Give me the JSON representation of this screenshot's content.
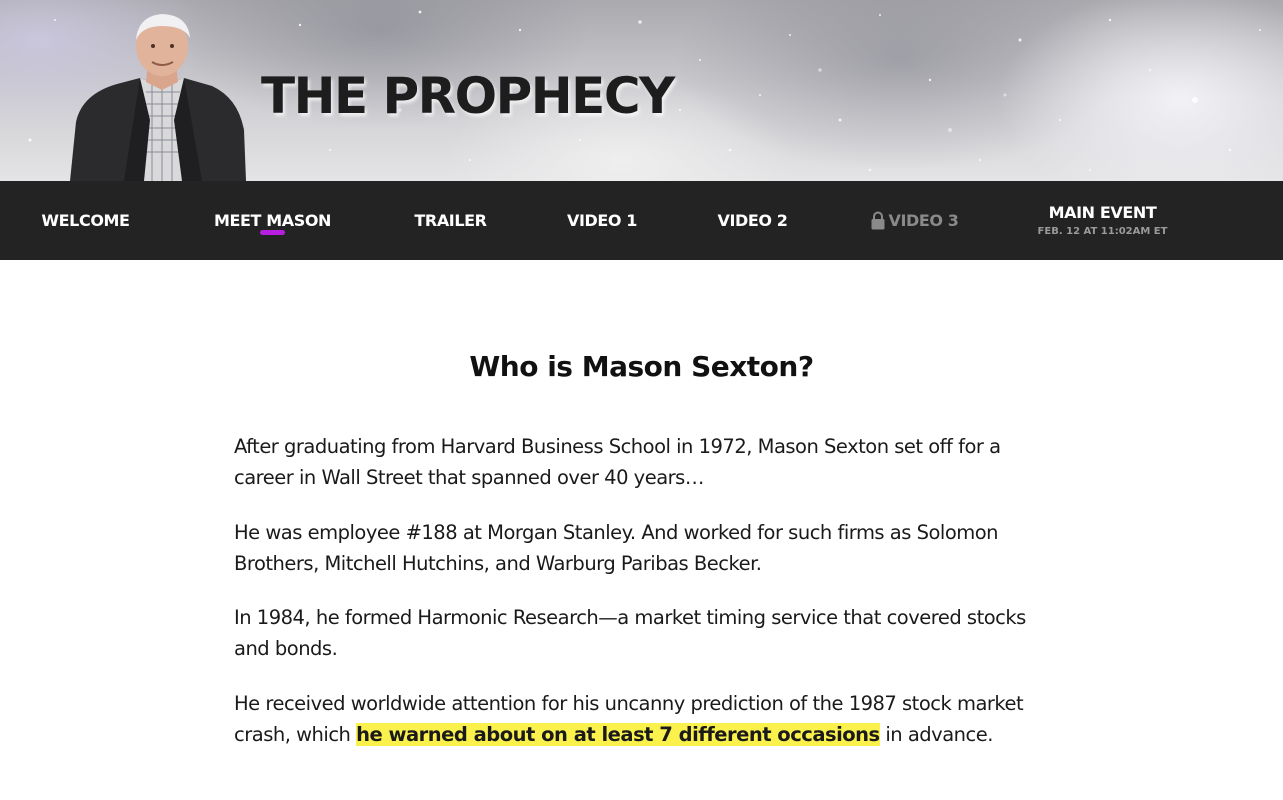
{
  "header": {
    "title": "THE PROPHECY",
    "portrait_alt": "Mason Sexton portrait"
  },
  "nav": {
    "items": [
      {
        "label": "WELCOME"
      },
      {
        "label": "MEET MASON",
        "active": true
      },
      {
        "label": "TRAILER"
      },
      {
        "label": "VIDEO 1"
      },
      {
        "label": "VIDEO 2"
      },
      {
        "label": "VIDEO 3",
        "locked": true
      },
      {
        "label": "MAIN EVENT",
        "sub": "FEB. 12 AT 11:02AM ET"
      }
    ],
    "active_color": "#b61fe0"
  },
  "article": {
    "heading": "Who is Mason Sexton?",
    "p1": "After graduating from Harvard Business School in 1972, Mason Sexton set off for a career in Wall Street that spanned over 40 years…",
    "p2": "He was employee #188 at Morgan Stanley. And worked for such firms as Solomon Brothers, Mitchell Hutchins, and Warburg Paribas Becker.",
    "p3": "In 1984, he formed Harmonic Research—a market timing service that covered stocks and bonds.",
    "p4_before": "He received worldwide attention for his uncanny prediction of the 1987 stock market crash, which ",
    "p4_highlight": "he warned about on at least 7 different occasions",
    "p4_after": " in advance.",
    "highlight_color": "#fbf14d"
  }
}
